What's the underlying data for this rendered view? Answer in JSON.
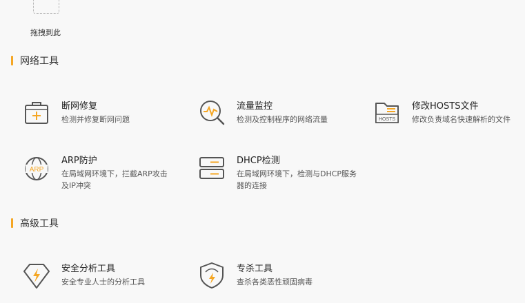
{
  "drop_zone": {
    "label": "拖拽到此"
  },
  "sections": {
    "network": {
      "title": "网络工具"
    },
    "advanced": {
      "title": "高级工具"
    }
  },
  "tools": {
    "repair": {
      "name": "断网修复",
      "desc": "检测并修复断网问题",
      "icon": "first-aid-kit-icon"
    },
    "traffic": {
      "name": "流量监控",
      "desc": "检测及控制程序的网络流量",
      "icon": "traffic-monitor-icon"
    },
    "hosts": {
      "name": "修改HOSTS文件",
      "desc": "修改负责域名快速解析的文件",
      "icon": "hosts-folder-icon"
    },
    "arp": {
      "name": "ARP防护",
      "desc": "在局域网环境下，拦截ARP攻击及IP冲突",
      "icon": "arp-globe-icon"
    },
    "dhcp": {
      "name": "DHCP检测",
      "desc": "在局域网环境下，检测与DHCP服务器的连接",
      "icon": "server-icon"
    },
    "security": {
      "name": "安全分析工具",
      "desc": "安全专业人士的分析工具",
      "icon": "diamond-bolt-icon"
    },
    "killer": {
      "name": "专杀工具",
      "desc": "查杀各类恶性顽固病毒",
      "icon": "shield-bolt-icon"
    }
  },
  "colors": {
    "accent": "#f5a623",
    "icon_stroke": "#555555",
    "background": "#f8f8f8"
  }
}
